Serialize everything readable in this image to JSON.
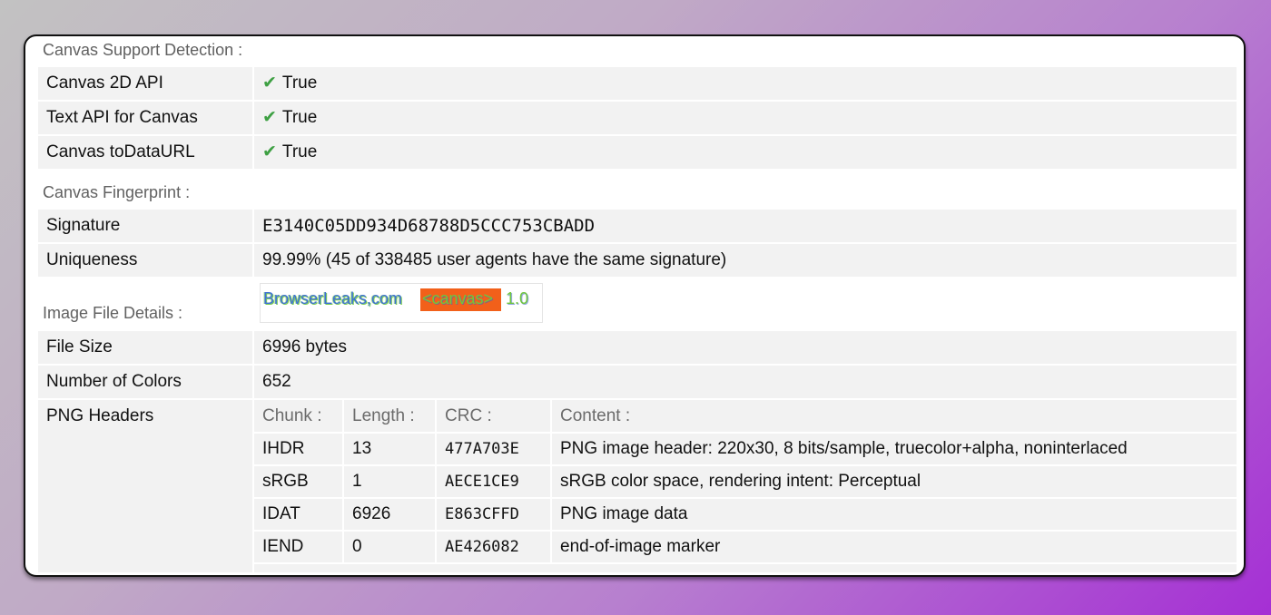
{
  "sections": {
    "support_title": "Canvas Support Detection :",
    "fingerprint_title": "Canvas Fingerprint :",
    "image_details_title": "Image File Details :"
  },
  "support": {
    "check_symbol": "✔",
    "rows": [
      {
        "label": "Canvas 2D API",
        "value": "True"
      },
      {
        "label": "Text API for Canvas",
        "value": "True"
      },
      {
        "label": "Canvas toDataURL",
        "value": "True"
      }
    ]
  },
  "fingerprint": {
    "signature_label": "Signature",
    "signature_value": "E3140C05DD934D68788D5CCC753CBADD",
    "uniqueness_label": "Uniqueness",
    "uniqueness_value": "99.99% (45 of 338485 user agents have the same signature)"
  },
  "canvas_image": {
    "text_part1": "BrowserLeaks,com",
    "text_part2": "<canvas>",
    "text_part3": "1.0",
    "highlight_color": "#f2601a",
    "text_color_blue": "#3e6fd8",
    "text_color_green": "#6fc63e"
  },
  "image_details": {
    "file_size_label": "File Size",
    "file_size_value": "6996 bytes",
    "colors_label": "Number of Colors",
    "colors_value": "652",
    "png_headers_label": "PNG Headers",
    "png_columns": [
      "Chunk :",
      "Length :",
      "CRC :",
      "Content :"
    ],
    "png_rows": [
      {
        "chunk": "IHDR",
        "length": "13",
        "crc": "477A703E",
        "content": "PNG image header: 220x30, 8 bits/sample, truecolor+alpha, noninterlaced"
      },
      {
        "chunk": "sRGB",
        "length": "1",
        "crc": "AECE1CE9",
        "content": "sRGB color space, rendering intent: Perceptual"
      },
      {
        "chunk": "IDAT",
        "length": "6926",
        "crc": "E863CFFD",
        "content": "PNG image data"
      },
      {
        "chunk": "IEND",
        "length": "0",
        "crc": "AE426082",
        "content": "end-of-image marker"
      }
    ]
  },
  "colors": {
    "check_green": "#3ea043",
    "row_background": "#f2f2f2"
  }
}
